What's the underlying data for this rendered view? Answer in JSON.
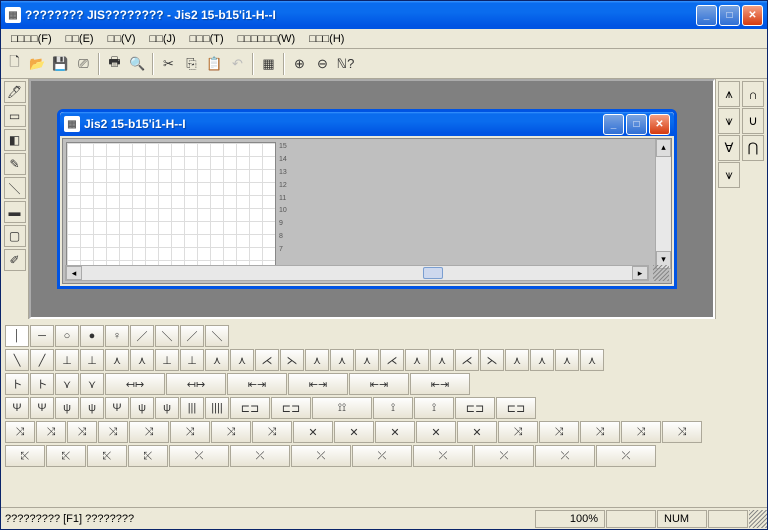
{
  "app": {
    "title": "???????? JIS???????? - Jis2 15-b15'i1-H--I",
    "title_icon": "▦"
  },
  "menu": {
    "file": "□□□□(F)",
    "edit": "□□(E)",
    "view": "□□(V)",
    "j": "□□(J)",
    "t": "□□□(T)",
    "window": "□□□□□□(W)",
    "help": "□□□(H)"
  },
  "child": {
    "title": "Jis2 15-b15'i1-H--I"
  },
  "ruler": [
    "15",
    "14",
    "13",
    "12",
    "11",
    "10",
    "9",
    "8",
    "7",
    ""
  ],
  "status": {
    "hint": "????????? [F1] ????????",
    "zoom": "100%",
    "num": "NUM"
  },
  "palette_row1": [
    {
      "g": "│",
      "w": "",
      "first": true
    },
    {
      "g": "─",
      "w": ""
    },
    {
      "g": "○",
      "w": ""
    },
    {
      "g": "●",
      "w": ""
    },
    {
      "g": "♀",
      "w": ""
    },
    {
      "g": "／",
      "w": ""
    },
    {
      "g": "＼",
      "w": ""
    },
    {
      "g": "／",
      "w": ""
    },
    {
      "g": "＼",
      "w": ""
    }
  ],
  "palette_row2": [
    {
      "g": "╲"
    },
    {
      "g": "╱"
    },
    {
      "g": "⊥"
    },
    {
      "g": "⊥"
    },
    {
      "g": "⋏"
    },
    {
      "g": "⋏"
    },
    {
      "g": "⊥"
    },
    {
      "g": "⊥"
    },
    {
      "g": "⋏"
    },
    {
      "g": "⋏"
    },
    {
      "g": "⋌"
    },
    {
      "g": "⋋"
    },
    {
      "g": "⋏"
    },
    {
      "g": "⋏"
    },
    {
      "g": "⋏"
    },
    {
      "g": "⋌"
    },
    {
      "g": "⋏"
    },
    {
      "g": "⋏"
    },
    {
      "g": "⋌"
    },
    {
      "g": "⋋"
    },
    {
      "g": "⋏"
    },
    {
      "g": "⋏"
    },
    {
      "g": "⋏"
    },
    {
      "g": "⋏"
    }
  ],
  "palette_row3": [
    {
      "g": "ト"
    },
    {
      "g": "ト"
    },
    {
      "g": "⋎"
    },
    {
      "g": "⋎"
    },
    {
      "g": "↤↦",
      "w": "w60"
    },
    {
      "g": "↤↦",
      "w": "w60"
    },
    {
      "g": "⇤⇥",
      "w": "w60"
    },
    {
      "g": "⇤⇥",
      "w": "w60"
    },
    {
      "g": "⇤⇥",
      "w": "w60"
    },
    {
      "g": "⇤⇥",
      "w": "w60"
    }
  ],
  "palette_row4": [
    {
      "g": "Ψ"
    },
    {
      "g": "Ψ"
    },
    {
      "g": "ψ"
    },
    {
      "g": "ψ"
    },
    {
      "g": "Ψ"
    },
    {
      "g": "ψ"
    },
    {
      "g": "ψ"
    },
    {
      "g": "|||"
    },
    {
      "g": "||||"
    },
    {
      "g": "⊏⊐",
      "w": "w40"
    },
    {
      "g": "⊏⊐",
      "w": "w40"
    },
    {
      "g": "⟟⟟",
      "w": "w60"
    },
    {
      "g": "⟟",
      "w": "w40"
    },
    {
      "g": "⟟",
      "w": "w40"
    },
    {
      "g": "⊏⊐",
      "w": "w40"
    },
    {
      "g": "⊏⊐",
      "w": "w40"
    }
  ],
  "palette_row5": [
    {
      "g": "⤨",
      "w": "w30"
    },
    {
      "g": "⤨",
      "w": "w30"
    },
    {
      "g": "⤨",
      "w": "w30"
    },
    {
      "g": "⤨",
      "w": "w30"
    },
    {
      "g": "⤨",
      "w": "w40"
    },
    {
      "g": "⤨",
      "w": "w40"
    },
    {
      "g": "⤨",
      "w": "w40"
    },
    {
      "g": "⤨",
      "w": "w40"
    },
    {
      "g": "✕",
      "w": "w40"
    },
    {
      "g": "✕",
      "w": "w40"
    },
    {
      "g": "✕",
      "w": "w40"
    },
    {
      "g": "✕",
      "w": "w40"
    },
    {
      "g": "✕",
      "w": "w40"
    },
    {
      "g": "⤨",
      "w": "w40"
    },
    {
      "g": "⤨",
      "w": "w40"
    },
    {
      "g": "⤨",
      "w": "w40"
    },
    {
      "g": "⤨",
      "w": "w40"
    },
    {
      "g": "⤨",
      "w": "w40"
    }
  ],
  "palette_row6": [
    {
      "g": "⤪",
      "w": "w40"
    },
    {
      "g": "⤪",
      "w": "w40"
    },
    {
      "g": "⤪",
      "w": "w40"
    },
    {
      "g": "⤪",
      "w": "w40"
    },
    {
      "g": "⤫",
      "w": "w60"
    },
    {
      "g": "⤫",
      "w": "w60"
    },
    {
      "g": "⤫",
      "w": "w60"
    },
    {
      "g": "⤫",
      "w": "w60"
    },
    {
      "g": "⤫",
      "w": "w60"
    },
    {
      "g": "⤫",
      "w": "w60"
    },
    {
      "g": "⤫",
      "w": "w60"
    },
    {
      "g": "⤫",
      "w": "w60"
    }
  ]
}
